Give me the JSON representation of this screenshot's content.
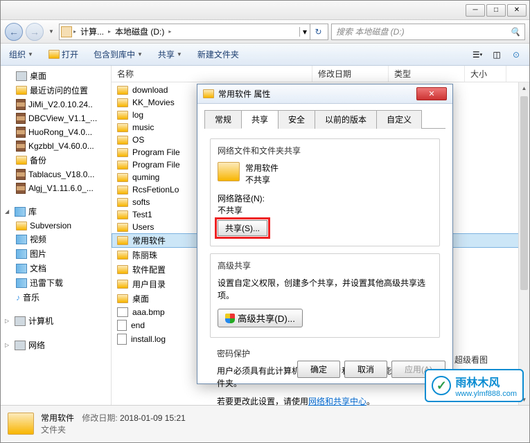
{
  "titlebar": {
    "min": "─",
    "max": "□",
    "close": "✕"
  },
  "nav": {
    "back": "←",
    "forward": "→",
    "dropdown": "▼",
    "refresh": "↻"
  },
  "breadcrumb": {
    "items": [
      "计算...",
      "本地磁盘 (D:)"
    ],
    "sep": "▸"
  },
  "search": {
    "placeholder": "搜索 本地磁盘 (D:)"
  },
  "toolbar": {
    "organize": "组织",
    "open": "打开",
    "include": "包含到库中",
    "share": "共享",
    "newfolder": "新建文件夹"
  },
  "sidebar": {
    "desktop": "桌面",
    "recent": "最近访问的位置",
    "archives": [
      "JiMi_V2.0.10.24..",
      "DBCView_V1.1_...",
      "HuoRong_V4.0...",
      "Kgzbbl_V4.60.0...",
      "备份",
      "Tablacus_V18.0...",
      "Algj_V1.11.6.0_..."
    ],
    "libraries_header": "库",
    "libraries": [
      "Subversion",
      "视频",
      "图片",
      "文档",
      "迅雷下载",
      "音乐"
    ],
    "computer": "计算机",
    "network": "网络"
  },
  "columns": {
    "name": "名称",
    "modified": "修改日期",
    "type": "类型",
    "size": "大小"
  },
  "files": [
    "download",
    "KK_Movies",
    "log",
    "music",
    "OS",
    "Program File",
    "Program File",
    "quming",
    "RcsFetionLo",
    "softs",
    "Test1",
    "Users",
    "常用软件",
    "陈丽珠",
    "软件配置",
    "用户目录",
    "桌面",
    "aaa.bmp",
    "end",
    "install.log"
  ],
  "selected_file": "常用软件",
  "dialog": {
    "title": "常用软件 属性",
    "tabs": [
      "常规",
      "共享",
      "安全",
      "以前的版本",
      "自定义"
    ],
    "active_tab": "共享",
    "section1_title": "网络文件和文件夹共享",
    "folder_name": "常用软件",
    "not_shared": "不共享",
    "netpath_label": "网络路径(N):",
    "netpath_value": "不共享",
    "share_btn": "共享(S)...",
    "section2_title": "高级共享",
    "section2_desc": "设置自定义权限，创建多个共享，并设置其他高级共享选项。",
    "adv_btn": "高级共享(D)...",
    "section3_title": "密码保护",
    "section3_desc1": "用户必须具有此计算机的用户帐户和密码，才能访问共享文件夹。",
    "section3_desc2": "若要更改此设置，请使用",
    "section3_link": "网络和共享中心",
    "section3_desc3": "。",
    "ok": "确定",
    "cancel": "取消",
    "apply": "应用(A)"
  },
  "context_hint": "超级看图",
  "status": {
    "name": "常用软件",
    "modified_label": "修改日期:",
    "modified_value": "2018-01-09 15:21",
    "type": "文件夹"
  },
  "watermark": {
    "brand": "雨林木风",
    "url": "www.ylmf888.com"
  }
}
